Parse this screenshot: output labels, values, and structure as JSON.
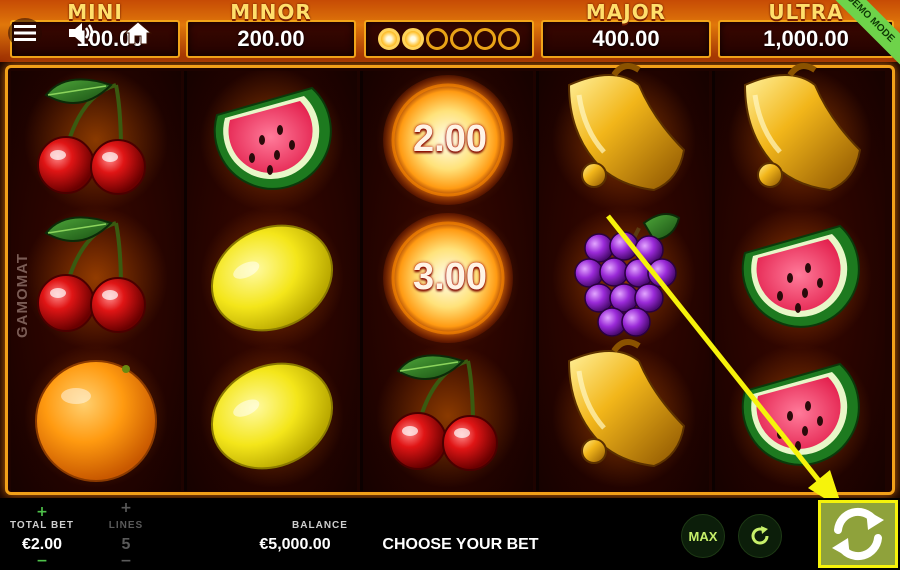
{
  "jackpots": {
    "mini": {
      "label": "MINI",
      "value": "100.00"
    },
    "minor": {
      "label": "MINOR",
      "value": "200.00"
    },
    "major": {
      "label": "MAJOR",
      "value": "400.00"
    },
    "ultra": {
      "label": "ULTRA",
      "value": "1,000.00"
    },
    "progress_dots": {
      "filled": 2,
      "total": 6
    }
  },
  "demo_ribbon": "DEMO MODE",
  "provider": "GAMOMAT",
  "reels": [
    [
      "cherries",
      "cherries",
      "orange"
    ],
    [
      "watermelon",
      "lemon",
      "lemon"
    ],
    [
      "fireball",
      "fireball",
      "cherries"
    ],
    [
      "bell",
      "grapes",
      "bell"
    ],
    [
      "bell",
      "watermelon",
      "watermelon"
    ]
  ],
  "fireball_values": {
    "top": "2.00",
    "middle": "3.00"
  },
  "bottom": {
    "total_bet_label": "TOTAL BET",
    "total_bet_value": "€2.00",
    "lines_label": "LINES",
    "lines_value": "5",
    "balance_label": "BALANCE",
    "balance_value": "€5,000.00",
    "message": "CHOOSE YOUR BET",
    "max_label": "MAX",
    "plus": "+",
    "minus": "−"
  },
  "colors": {
    "accent_gold": "#f1a019",
    "button_green": "#4ec24a",
    "annotation_yellow": "#f6f30b"
  }
}
